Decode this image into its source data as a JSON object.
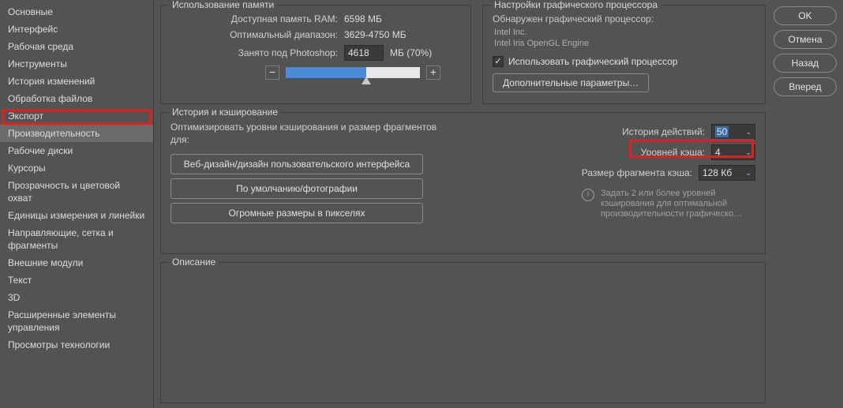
{
  "sidebar": {
    "items": [
      "Основные",
      "Интерфейс",
      "Рабочая среда",
      "Инструменты",
      "История изменений",
      "Обработка файлов",
      "Экспорт",
      "Производительность",
      "Рабочие диски",
      "Курсоры",
      "Прозрачность и цветовой охват",
      "Единицы измерения и линейки",
      "Направляющие, сетка и фрагменты",
      "Внешние модули",
      "Текст",
      "3D",
      "Расширенные элементы управления",
      "Просмотры технологии"
    ],
    "selected_index": 7
  },
  "memory": {
    "title": "Использование памяти",
    "avail_label": "Доступная память RAM:",
    "avail_value": "6598 МБ",
    "range_label": "Оптимальный диапазон:",
    "range_value": "3629-4750 МБ",
    "used_label": "Занято под Photoshop:",
    "used_value": "4618",
    "used_suffix": "МБ (70%)",
    "minus": "−",
    "plus": "+"
  },
  "gpu": {
    "title": "Настройки графического процессора",
    "detected_label": "Обнаружен графический процессор:",
    "vendor": "Intel Inc.",
    "engine": "Intel Iris OpenGL Engine",
    "checkbox_label": "Использовать графический процессор",
    "checked": true,
    "adv_btn": "Дополнительные параметры…"
  },
  "history": {
    "title": "История и кэширование",
    "opt_label": "Оптимизировать уровни кэширования и размер фрагментов для:",
    "btn1": "Веб-дизайн/дизайн пользовательского интерфейса",
    "btn2": "По умолчанию/фотографии",
    "btn3": "Огромные размеры в пикселях",
    "states_label": "История действий:",
    "states_value": "50",
    "cache_levels_label": "Уровней кэша:",
    "cache_levels_value": "4",
    "tile_label": "Размер фрагмента кэша:",
    "tile_value": "128 Кб",
    "hint": "Задать 2 или более уровней кэширования для оптимальной производительности графическо…"
  },
  "desc": {
    "title": "Описание"
  },
  "buttons": {
    "ok": "OK",
    "cancel": "Отмена",
    "back": "Назад",
    "forward": "Вперед"
  }
}
